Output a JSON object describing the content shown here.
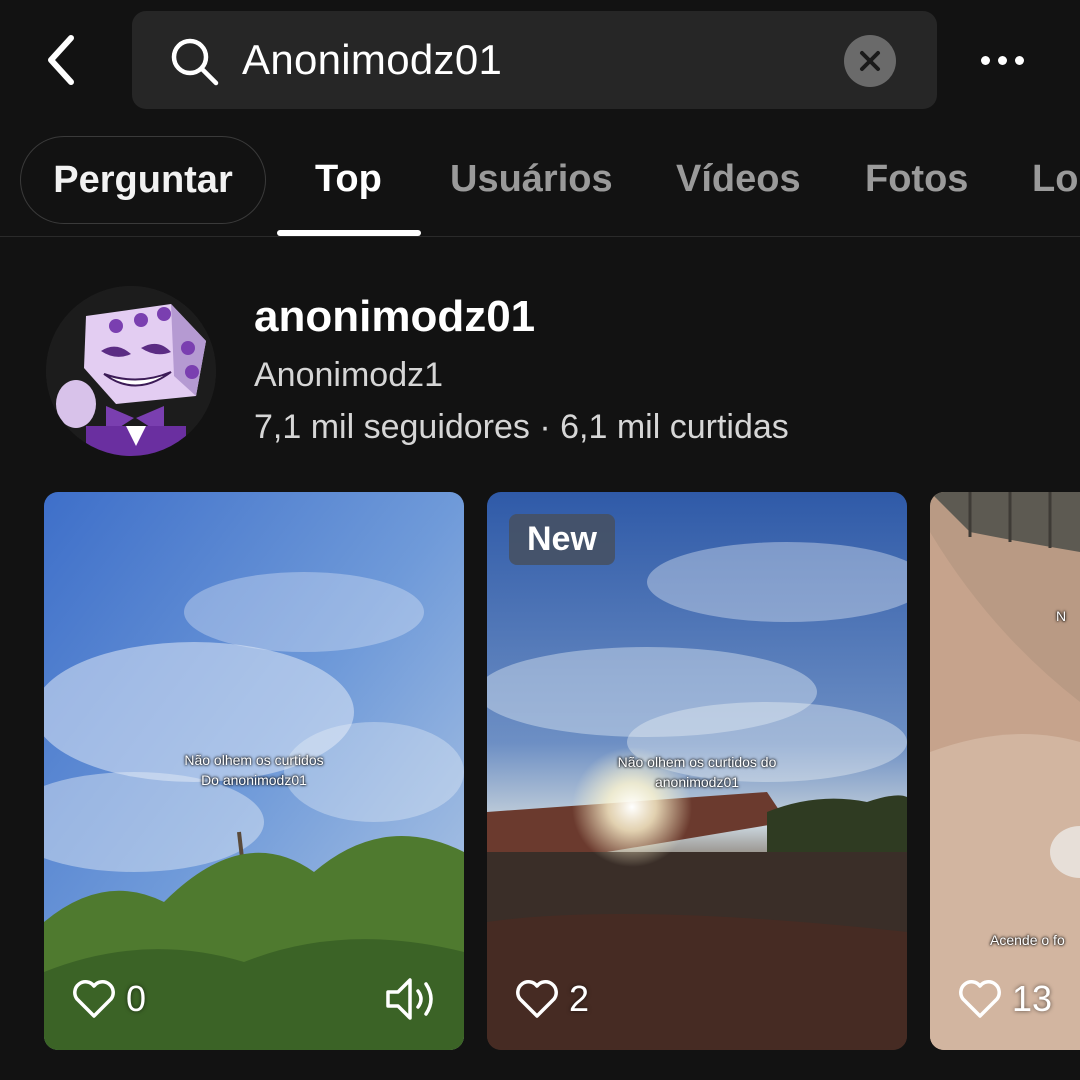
{
  "search": {
    "value": "Anonimodz01",
    "icons": {
      "back": "chevron-left-icon",
      "search": "search-icon",
      "clear": "close-icon",
      "more": "more-horizontal-icon"
    }
  },
  "tabs": {
    "ask_label": "Perguntar",
    "items": [
      {
        "label": "Top",
        "active": true
      },
      {
        "label": "Usuários",
        "active": false
      },
      {
        "label": "Vídeos",
        "active": false
      },
      {
        "label": "Fotos",
        "active": false
      },
      {
        "label": "Lo",
        "active": false
      }
    ]
  },
  "profile": {
    "username": "anonimodz01",
    "nickname": "Anonimodz1",
    "stats": "7,1 mil seguidores · 6,1 mil curtidas"
  },
  "videos": [
    {
      "caption_line1": "Não olhem os curtidos",
      "caption_line2": "Do anonimodz01",
      "likes": "0",
      "badge": "",
      "has_sound_icon": true
    },
    {
      "caption_line1": "Não olhem os curtidos do",
      "caption_line2": "anonimodz01",
      "likes": "2",
      "badge": "New",
      "has_sound_icon": false
    },
    {
      "caption_line1": "N",
      "caption_line2": "Acende o fo",
      "likes": "13",
      "badge": "",
      "has_sound_icon": false
    }
  ],
  "colors": {
    "background": "#121212",
    "search_bg": "#262626",
    "tab_inactive": "#9a9a9a",
    "accent": "#ffffff"
  }
}
